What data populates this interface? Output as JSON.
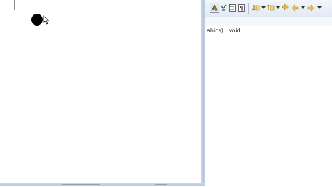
{
  "outline": {
    "signature": "ahics) : void"
  },
  "colors": {
    "canvas_background": "#ffffff",
    "shape_fill": "#000000",
    "window_frame": "#c3d1e3",
    "toolbar_background": "#e8eef6"
  },
  "icons": [
    "paint-shape-icon",
    "toggle-mark-icon",
    "show-whitespace-icon",
    "paragraph-icon",
    "next-annotation-icon",
    "previous-annotation-icon",
    "back-icon",
    "forward-icon"
  ]
}
